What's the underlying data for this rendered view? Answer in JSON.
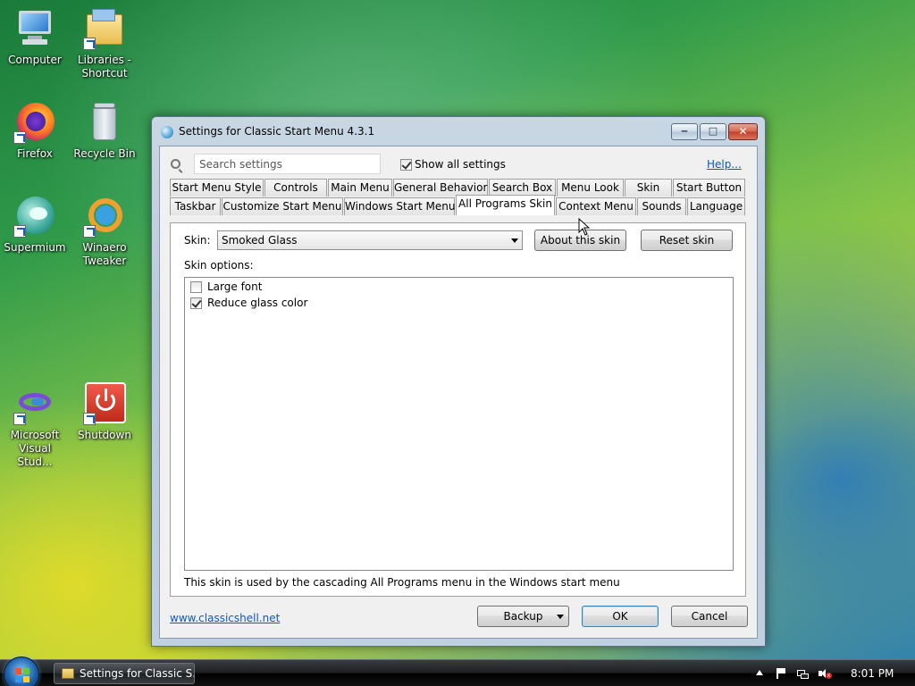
{
  "desktop": {
    "icons": [
      {
        "label": "Computer",
        "icon": "computer-icon"
      },
      {
        "label": "Libraries - Shortcut",
        "icon": "libraries-folder-icon"
      },
      {
        "label": "Firefox",
        "icon": "firefox-icon"
      },
      {
        "label": "Recycle Bin",
        "icon": "recycle-bin-icon"
      },
      {
        "label": "Supermium",
        "icon": "supermium-icon"
      },
      {
        "label": "Winaero Tweaker",
        "icon": "winaero-tweaker-icon"
      },
      {
        "label": "Microsoft Visual Stud...",
        "icon": "visual-studio-icon"
      },
      {
        "label": "Shutdown",
        "icon": "shutdown-icon"
      }
    ]
  },
  "window": {
    "title": "Settings for Classic Start Menu 4.3.1",
    "search": {
      "placeholder": "Search settings"
    },
    "show_all_label": "Show all settings",
    "show_all_checked": true,
    "help_label": "Help...",
    "tabs_row1": [
      "Start Menu Style",
      "Controls",
      "Main Menu",
      "General Behavior",
      "Search Box",
      "Menu Look",
      "Skin",
      "Start Button"
    ],
    "tabs_row2": [
      "Taskbar",
      "Customize Start Menu",
      "Windows Start Menu",
      "All Programs Skin",
      "Context Menu",
      "Sounds",
      "Language"
    ],
    "active_tab": "All Programs Skin",
    "skin": {
      "label": "Skin:",
      "selected": "Smoked Glass",
      "about_button": "About this skin",
      "reset_button": "Reset skin",
      "options_label": "Skin options:",
      "options": [
        {
          "label": "Large font",
          "checked": false
        },
        {
          "label": "Reduce glass color",
          "checked": true
        }
      ],
      "description": "This skin is used by the cascading All Programs menu in the Windows start menu"
    },
    "footer": {
      "link": "www.classicshell.net",
      "backup_button": "Backup",
      "ok_button": "OK",
      "cancel_button": "Cancel"
    }
  },
  "taskbar": {
    "task_label": "Settings for Classic S...",
    "clock": "8:01 PM"
  },
  "colors": {
    "link": "#0f56c8",
    "close_button": "#c1402a"
  }
}
